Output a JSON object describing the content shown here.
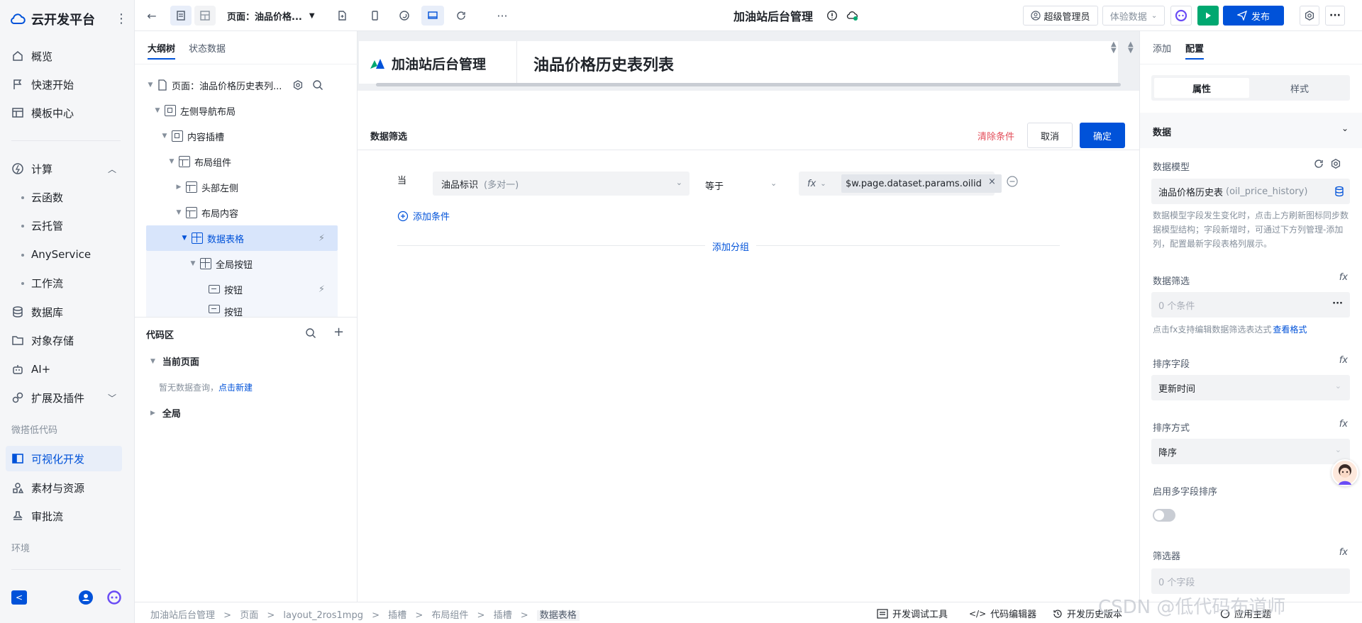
{
  "colors": {
    "accent": "#0052d9",
    "danger": "#e34d59",
    "muted": "#86909c",
    "selected_row": "#d8e5fb",
    "active_nav": "#e8eef9",
    "canvas_bg": "#eef0f3"
  },
  "sidebar": {
    "brand": "云开发平台",
    "items": [
      {
        "label": "概览",
        "icon": "home-icon"
      },
      {
        "label": "快速开始",
        "icon": "flag-icon"
      },
      {
        "label": "模板中心",
        "icon": "template-icon"
      }
    ],
    "compute": {
      "label": "计算",
      "icon": "compute-icon",
      "children": [
        "云函数",
        "云托管",
        "AnyService",
        "工作流"
      ]
    },
    "items2": [
      {
        "label": "数据库",
        "icon": "database-icon"
      },
      {
        "label": "对象存储",
        "icon": "storage-icon"
      },
      {
        "label": "AI+",
        "icon": "robot-icon"
      },
      {
        "label": "扩展及插件",
        "icon": "plugin-icon"
      }
    ],
    "section_lowcode": "微搭低代码",
    "items3": [
      {
        "label": "可视化开发",
        "icon": "layout-icon",
        "active": true
      },
      {
        "label": "素材与资源",
        "icon": "assets-icon"
      },
      {
        "label": "审批流",
        "icon": "stamp-icon"
      }
    ],
    "section_env": "环境"
  },
  "topbar": {
    "page_select": "页面：油品价格...",
    "app_title": "加油站后台管理",
    "role_label": "超级管理员",
    "env_select": "体验数据",
    "publish_label": "发布"
  },
  "outline": {
    "tab_tree": "大纲树",
    "tab_state": "状态数据",
    "nodes": [
      {
        "label": "页面：油品价格历史表列...",
        "depth": 0,
        "arrow": "▾"
      },
      {
        "label": "左侧导航布局",
        "depth": 1,
        "arrow": "▾"
      },
      {
        "label": "内容插槽",
        "depth": 2,
        "arrow": "▾"
      },
      {
        "label": "布局组件",
        "depth": 3,
        "arrow": "▾"
      },
      {
        "label": "头部左侧",
        "depth": 4,
        "arrow": "▸"
      },
      {
        "label": "布局内容",
        "depth": 4,
        "arrow": "▾"
      },
      {
        "label": "数据表格",
        "depth": 5,
        "arrow": "▾",
        "selected": true
      },
      {
        "label": "全局按钮",
        "depth": 6,
        "arrow": "▾"
      },
      {
        "label": "按钮",
        "depth": 7,
        "arrow": ""
      },
      {
        "label": "按钮",
        "depth": 7,
        "arrow": ""
      }
    ]
  },
  "code": {
    "title": "代码区",
    "current_page": "当前页面",
    "empty_text": "暂无数据查询，",
    "create_link": "点击新建",
    "global": "全局"
  },
  "canvas": {
    "preview_brand": "加油站后台管理",
    "preview_title": "油品价格历史表列表",
    "filter_title": "数据筛选",
    "clear_label": "清除条件",
    "cancel_label": "取消",
    "confirm_label": "确定",
    "when_label": "当",
    "field": "油品标识",
    "field_hint": "(多对一)",
    "operator": "等于",
    "fx": "fx",
    "value_expr": "$w.page.dataset.params.oilid",
    "add_condition": "添加条件",
    "add_group": "添加分组"
  },
  "right": {
    "tab_add": "添加",
    "tab_config": "配置",
    "seg_props": "属性",
    "seg_style": "样式",
    "section_data": "数据",
    "model_label": "数据模型",
    "model_value": "油品价格历史表",
    "model_hint": "(oil_price_history)",
    "model_help": "数据模型字段发生变化时，点击上方刷新图标同步数据模型结构；字段新增时，可通过下方列管理-添加列，配置最新字段表格列展示。",
    "filter_label": "数据筛选",
    "filter_value": "0 个条件",
    "filter_help": "点击fx支持编辑数据筛选表达式",
    "filter_link": "查看格式",
    "sort_field_label": "排序字段",
    "sort_field_value": "更新时间",
    "sort_order_label": "排序方式",
    "sort_order_value": "降序",
    "multi_sort_label": "启用多字段排序",
    "filterer_label": "筛选器",
    "filterer_value": "0 个字段",
    "fx": "fx"
  },
  "bottom": {
    "breadcrumb": [
      "加油站后台管理",
      "页面",
      "layout_2ros1mpg",
      "插槽",
      "布局组件",
      "插槽",
      "数据表格"
    ],
    "debug": "开发调试工具",
    "code_editor": "代码编辑器",
    "history": "开发历史版本",
    "theme": "应用主题",
    "watermark": "CSDN @低代码布道师"
  }
}
